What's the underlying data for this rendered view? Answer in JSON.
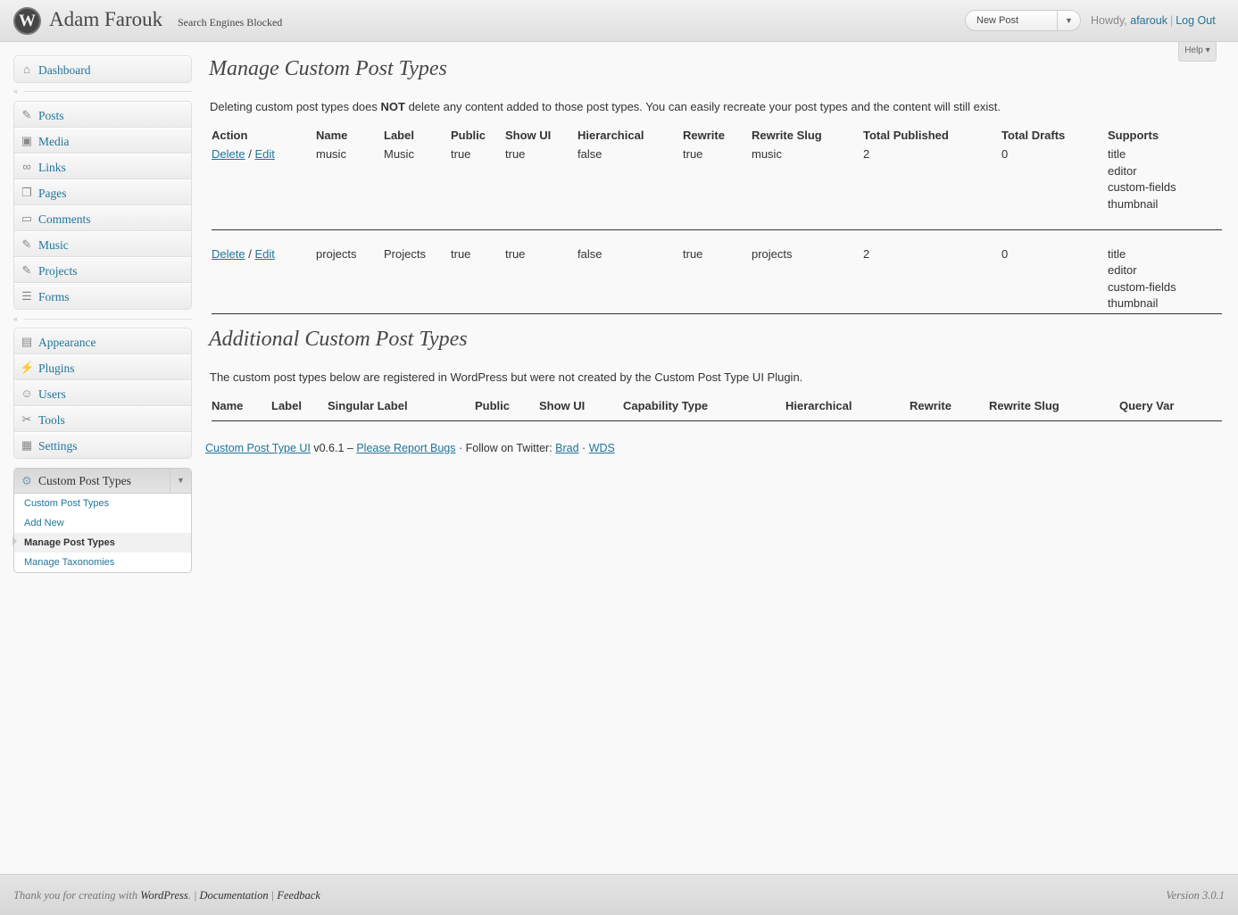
{
  "header": {
    "site_title": "Adam Farouk",
    "se_notice": "Search Engines Blocked",
    "favorite_label": "New Post",
    "howdy": "Howdy,",
    "username": "afarouk",
    "logout": "Log Out",
    "help": "Help"
  },
  "menu": {
    "dashboard": "Dashboard",
    "group1": [
      "Posts",
      "Media",
      "Links",
      "Pages",
      "Comments",
      "Music",
      "Projects",
      "Forms"
    ],
    "group2": [
      "Appearance",
      "Plugins",
      "Users",
      "Tools",
      "Settings"
    ],
    "cpt_head": "Custom Post Types",
    "cpt_sub": [
      "Custom Post Types",
      "Add New",
      "Manage Post Types",
      "Manage Taxonomies"
    ]
  },
  "main": {
    "title": "Manage Custom Post Types",
    "desc_pre": "Deleting custom post types does ",
    "desc_bold": "NOT",
    "desc_post": " delete any content added to those post types. You can easily recreate your post types and the content will still exist.",
    "columns": [
      "Action",
      "Name",
      "Label",
      "Public",
      "Show UI",
      "Hierarchical",
      "Rewrite",
      "Rewrite Slug",
      "Total Published",
      "Total Drafts",
      "Supports"
    ],
    "delete_label": "Delete",
    "action_sep": "/",
    "edit_label": "Edit",
    "rows": [
      {
        "name": "music",
        "label": "Music",
        "public": "true",
        "show_ui": "true",
        "hierarchical": "false",
        "rewrite": "true",
        "slug": "music",
        "published": "2",
        "drafts": "0",
        "supports": [
          "title",
          "editor",
          "custom-fields",
          "thumbnail"
        ]
      },
      {
        "name": "projects",
        "label": "Projects",
        "public": "true",
        "show_ui": "true",
        "hierarchical": "false",
        "rewrite": "true",
        "slug": "projects",
        "published": "2",
        "drafts": "0",
        "supports": [
          "title",
          "editor",
          "custom-fields",
          "thumbnail"
        ]
      }
    ],
    "additional_title": "Additional Custom Post Types",
    "additional_desc": "The custom post types below are registered in WordPress but were not created by the Custom Post Type UI Plugin.",
    "additional_columns": [
      "Name",
      "Label",
      "Singular Label",
      "Public",
      "Show UI",
      "Capability Type",
      "Hierarchical",
      "Rewrite",
      "Rewrite Slug",
      "Query Var"
    ],
    "plugin_link": "Custom Post Type UI",
    "plugin_version": "v0.6.1 –",
    "report_bugs": "Please Report Bugs",
    "follow_text": "· Follow on Twitter:",
    "twitter_brad": "Brad",
    "dot": "·",
    "twitter_wds": "WDS"
  },
  "footer": {
    "thanks": "Thank you for creating with",
    "wordpress": "WordPress",
    "documentation": "Documentation",
    "feedback": "Feedback",
    "version": "Version 3.0.1"
  }
}
